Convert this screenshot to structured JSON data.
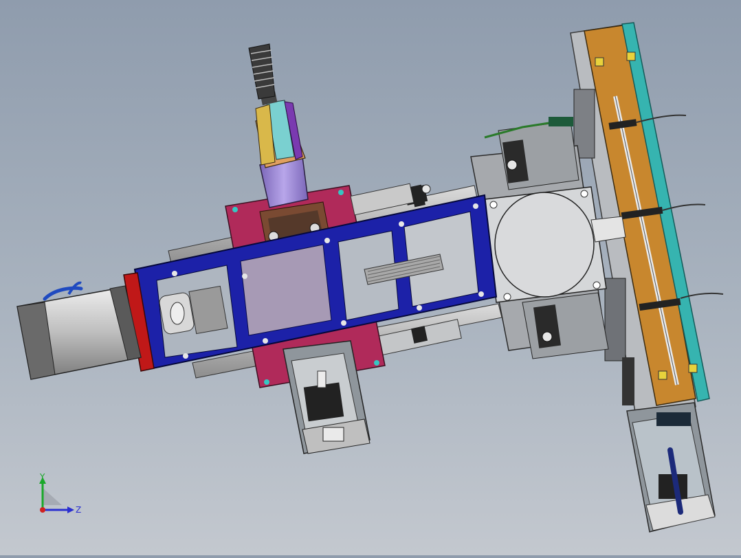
{
  "viewport": {
    "background_top": "#8f9cad",
    "background_bottom": "#c3c8cf"
  },
  "triad": {
    "y_label": "Y",
    "z_label": "Z",
    "y_color": "#1aa82a",
    "z_color": "#2a2fd0",
    "x_color": "#d02020"
  },
  "colors": {
    "frame_blue": "#1c21a8",
    "carriage_magenta": "#b02a5a",
    "plate_orange": "#c8872e",
    "rail_teal": "#36b4b0",
    "motor_grey": "#c9c9c9",
    "cylinder_violet": "#9b84d0",
    "end_red": "#c01818"
  },
  "icons": [
    "coordinate-triad-icon"
  ]
}
